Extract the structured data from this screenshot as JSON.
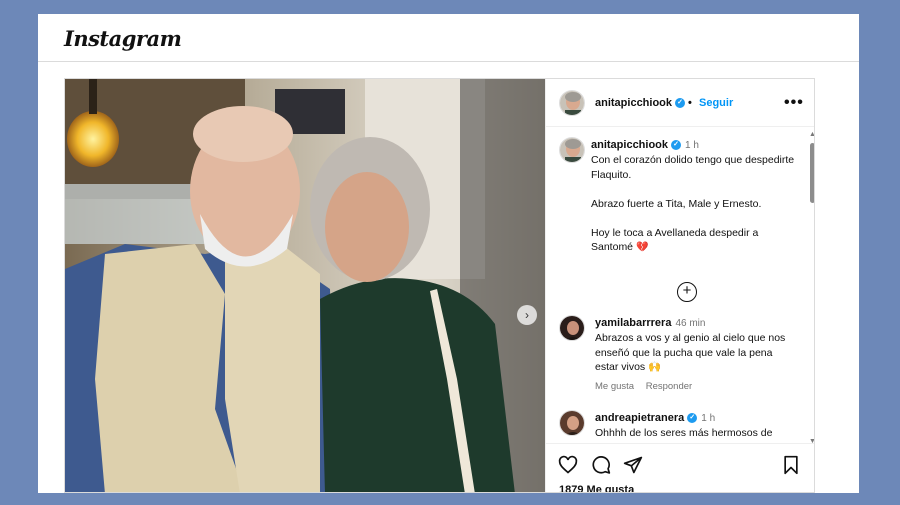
{
  "header": {
    "logo_text": "Instagram"
  },
  "post": {
    "author": "anitapicchiook",
    "follow_label": "Seguir",
    "more_label": "•••",
    "caption": {
      "time": "1 h",
      "lines": [
        "Con el corazón dolido tengo que despedirte Flaquito.",
        "Abrazo fuerte a Tita, Male y Ernesto.",
        "Hoy le toca a  Avellaneda despedir a Santomé"
      ],
      "emoji": "💔"
    },
    "comments": [
      {
        "user": "yamilabarrrera",
        "time": "46 min",
        "text": "Abrazos a vos y al genio al cielo que nos enseñó que la pucha que vale la pena estar vivos",
        "emoji": "🙌",
        "like_label": "Me gusta",
        "reply_label": "Responder"
      },
      {
        "user": "andreapietranera",
        "time": "1 h",
        "text": "Ohhhh de los seres más hermosos de"
      }
    ],
    "likes_text": "1879 Me gusta"
  },
  "icons": {
    "verified": "verified-badge-icon",
    "like": "heart-icon",
    "comment": "comment-bubble-icon",
    "share": "paper-plane-icon",
    "save": "bookmark-icon",
    "add": "plus-circle-icon",
    "next": "chevron-right-icon"
  },
  "colors": {
    "background": "#6d88b8",
    "link_blue": "#0095f6",
    "verified_blue": "#1d9bf0",
    "muted_text": "#737373"
  }
}
